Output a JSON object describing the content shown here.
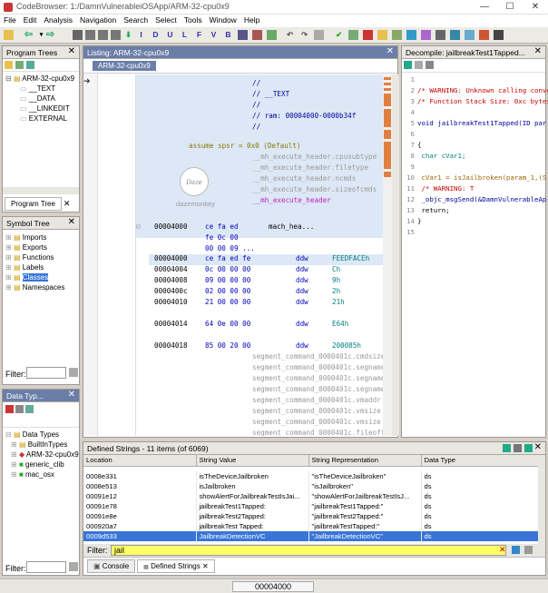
{
  "window": {
    "title": "CodeBrowser: 1:/DamnVulnerableiOSApp/ARM-32-cpu0x9",
    "minimize": "—",
    "maximize": "☐",
    "close": "✕"
  },
  "menu": [
    "File",
    "Edit",
    "Analysis",
    "Navigation",
    "Search",
    "Select",
    "Tools",
    "Window",
    "Help"
  ],
  "toolbar_letters": [
    "I",
    "D",
    "U",
    "L",
    "F",
    "V",
    "B"
  ],
  "program_trees": {
    "title": "Program Trees",
    "items": [
      "ARM-32-cpu0x9",
      "__TEXT",
      "__DATA",
      "__LINKEDIT",
      "EXTERNAL"
    ],
    "tab": "Program Tree"
  },
  "symbol_tree": {
    "title": "Symbol Tree",
    "items": [
      "Imports",
      "Exports",
      "Functions",
      "Labels",
      "Classes",
      "Namespaces"
    ],
    "filter_label": "Filter:"
  },
  "data_types": {
    "title": "Data Typ...",
    "items": [
      "Data Types",
      "BuiltInTypes",
      "ARM-32-cpu0x9",
      "generic_clib",
      "mac_osx"
    ],
    "filter_label": "Filter:"
  },
  "listing": {
    "title": "Listing:  ARM-32-cpu0x9",
    "tab": "ARM-32-cpu0x9",
    "comments": [
      "//",
      "// __TEXT",
      "//",
      "// ram: 00004000-0000b34f",
      "//"
    ],
    "assume": "assume spsr = 0x0  (Default)",
    "header_refs": [
      "__mh_execute_header.cpusubtype",
      "__mh_execute_header.filetype",
      "__mh_execute_header.ncmds",
      "__mh_execute_header.sizeofcmds",
      "__mh_execute_header"
    ],
    "watermark": "dazemonkey",
    "watermark_logo": "Daze",
    "header_row": {
      "addr": "00004000",
      "bytes": "ce fa ed",
      "label": "mach_hea..."
    },
    "extra_bytes": [
      "fe 0c 00",
      "00 00 09 ..."
    ],
    "rows": [
      {
        "addr": "00004000",
        "bytes": "ce fa ed fe",
        "mnem": "ddw",
        "val": "FEEDFACEh"
      },
      {
        "addr": "00004004",
        "bytes": "0c 00 00 00",
        "mnem": "ddw",
        "val": "Ch"
      },
      {
        "addr": "00004008",
        "bytes": "09 00 00 00",
        "mnem": "ddw",
        "val": "9h"
      },
      {
        "addr": "0000400c",
        "bytes": "02 00 00 00",
        "mnem": "ddw",
        "val": "2h"
      },
      {
        "addr": "00004010",
        "bytes": "21 00 00 00",
        "mnem": "ddw",
        "val": "21h"
      },
      {
        "addr": "00004014",
        "bytes": "64 0e 00 00",
        "mnem": "ddw",
        "val": "E64h"
      },
      {
        "addr": "00004018",
        "bytes": "85 00 20 00",
        "mnem": "ddw",
        "val": "200085h"
      }
    ],
    "segment_refs": [
      "segment_command_0000401c.cmdsize",
      "segment_command_0000401c.segname",
      "segment_command_0000401c.segname",
      "segment_command_0000401c.segname",
      "segment_command_0000401c.vmaddr",
      "segment_command_0000401c.vmsize",
      "segment_command_0000401c.vmsize",
      "segment_command_0000401c.fileoff"
    ]
  },
  "decompile": {
    "title": "Decompile: jailbreakTest1Tapped...",
    "lines": [
      {
        "n": "1",
        "t": ""
      },
      {
        "n": "2",
        "t": "/* WARNING: Unknown calling conve"
      },
      {
        "n": "3",
        "t": "/* Function Stack Size: 0xc bytes"
      },
      {
        "n": "4",
        "t": ""
      },
      {
        "n": "5",
        "t": "void jailbreakTest1Tapped(ID par"
      },
      {
        "n": "6",
        "t": ""
      },
      {
        "n": "7",
        "t": "{"
      },
      {
        "n": "8",
        "t": "  char cVar1;"
      },
      {
        "n": "9",
        "t": ""
      },
      {
        "n": "10",
        "t": "  cVar1 = isJailbroken(param_1,(S"
      },
      {
        "n": "11",
        "t": "                    /* WARNING: T"
      },
      {
        "n": "12",
        "t": "  _objc_msgSend(&DamnVulnerableAp"
      },
      {
        "n": "13",
        "t": "  return;"
      },
      {
        "n": "14",
        "t": "}"
      },
      {
        "n": "15",
        "t": ""
      }
    ]
  },
  "defined_strings": {
    "title": "Defined Strings - 11 items (of 6069)",
    "columns": [
      "Location",
      "String Value",
      "String Representation",
      "Data Type"
    ],
    "rows": [
      {
        "loc": "0008e331",
        "val": "isTheDeviceJailbroken",
        "rep": "\"isTheDeviceJailbroken\"",
        "type": "ds"
      },
      {
        "loc": "0008e513",
        "val": "isJailbroken",
        "rep": "\"isJailbroken\"",
        "type": "ds"
      },
      {
        "loc": "00091e12",
        "val": "showAlertForJailbreakTestIsJai...",
        "rep": "\"showAlertForJailbreakTestIsJ...",
        "type": "ds"
      },
      {
        "loc": "00091e78",
        "val": "jailbreakTest1Tapped:",
        "rep": "\"jailbreakTest1Tapped:\"",
        "type": "ds"
      },
      {
        "loc": "00091e8e",
        "val": "jailbreakTest2Tapped:",
        "rep": "\"jailbreakTest2Tapped:\"",
        "type": "ds"
      },
      {
        "loc": "000920a7",
        "val": "jailbreakTest Tapped:",
        "rep": "\"jailbreakTestTapped:\"",
        "type": "ds"
      },
      {
        "loc": "0009d533",
        "val": "JailbreakDetectionVC",
        "rep": "\"JailbreakDetectionVC\"",
        "type": "ds"
      }
    ],
    "filter_label": "Filter:",
    "filter_value": "jail"
  },
  "bottom_tabs": [
    "Console",
    "Defined Strings"
  ],
  "status": {
    "address": "00004000"
  }
}
